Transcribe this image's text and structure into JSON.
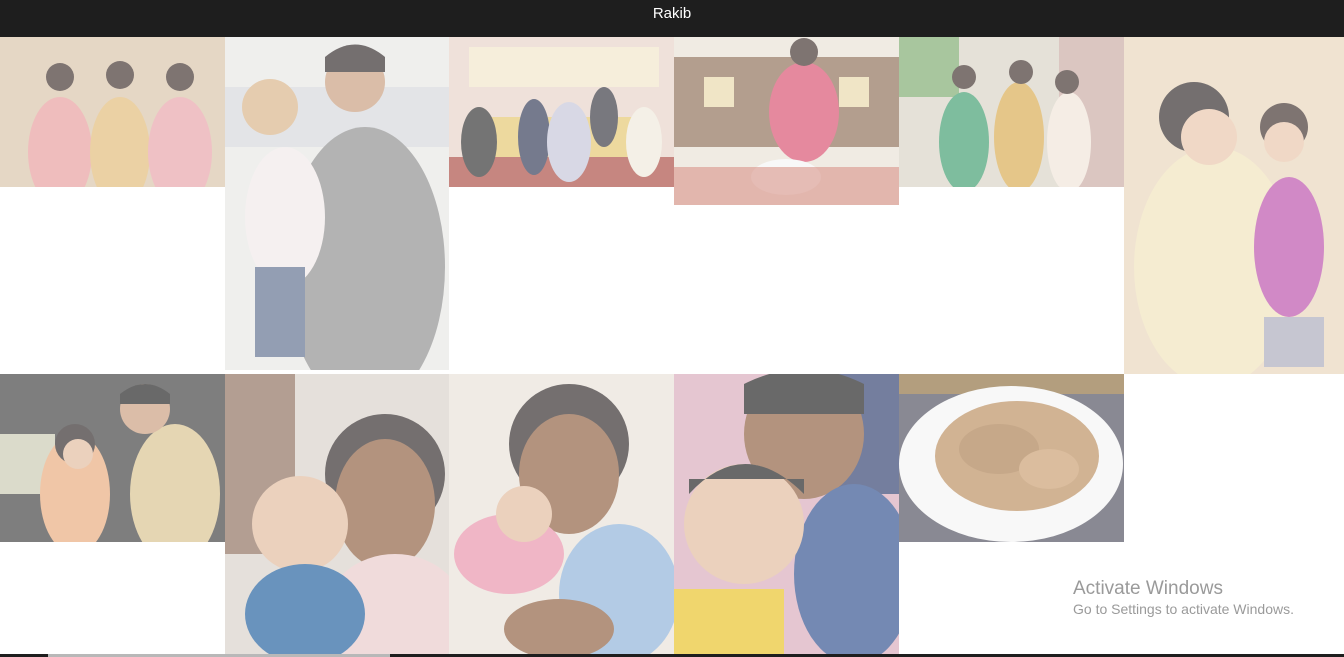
{
  "header": {
    "title": "Rakib"
  },
  "gallery": {
    "photos": [
      {
        "subject": "three women in festive sarees",
        "icon": "photo-icon"
      },
      {
        "subject": "man holding baby in knit hat on rooftop",
        "icon": "photo-icon"
      },
      {
        "subject": "wedding stage group portrait",
        "icon": "photo-icon"
      },
      {
        "subject": "girl with birthday cake and candles",
        "icon": "photo-icon"
      },
      {
        "subject": "three people standing in lane",
        "icon": "photo-icon"
      },
      {
        "subject": "woman holding toddler girl",
        "icon": "photo-icon"
      },
      {
        "subject": "couple selfie in car",
        "icon": "photo-icon"
      },
      {
        "subject": "mother with baby in blue",
        "icon": "photo-icon"
      },
      {
        "subject": "mother holding sleeping newborn",
        "icon": "photo-icon"
      },
      {
        "subject": "girl and small boy selfie",
        "icon": "photo-icon"
      },
      {
        "subject": "plate of biryani",
        "icon": "photo-icon"
      }
    ]
  },
  "watermark": {
    "title": "Activate Windows",
    "subtitle": "Go to Settings to activate Windows."
  },
  "colors": {
    "header_bg": "#1e1e1e",
    "header_text": "#ffffff",
    "watermark_text": "#9a9a9a"
  }
}
